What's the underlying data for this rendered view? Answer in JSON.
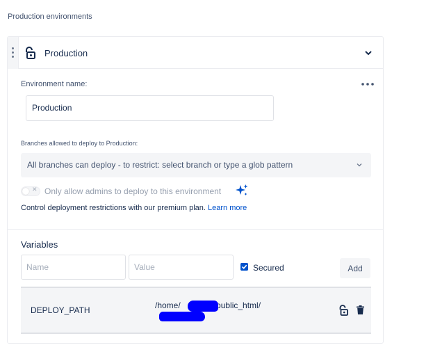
{
  "section": {
    "title": "Production environments"
  },
  "environment": {
    "title": "Production",
    "name_label": "Environment name:",
    "name_value": "Production",
    "branches_label": "Branches allowed to deploy to Production:",
    "branches_select_value": "All branches can deploy - to restrict: select branch or type a glob pattern",
    "admins_toggle_label": "Only allow admins to deploy to this environment",
    "admins_toggle_on": false,
    "premium_text": "Control deployment restrictions with our premium plan.",
    "premium_link": "Learn more"
  },
  "variables": {
    "title": "Variables",
    "name_placeholder": "Name",
    "value_placeholder": "Value",
    "secured_label": "Secured",
    "secured_checked": true,
    "add_label": "Add",
    "rows": [
      {
        "key": "DEPLOY_PATH",
        "value": "/home/    /public_html/     "
      }
    ]
  },
  "icons": {
    "drag": "drag-handle-icon",
    "lock": "unlock-icon",
    "chevron": "chevron-down-icon",
    "more": "more-icon",
    "sparkle": "sparkle-icon",
    "trash": "trash-icon"
  },
  "colors": {
    "accent": "#0052cc",
    "text": "#172b4d",
    "muted": "#42526e",
    "subtle_bg": "#f4f5f7",
    "border": "#ebecf0",
    "redaction": "#0000ff"
  }
}
